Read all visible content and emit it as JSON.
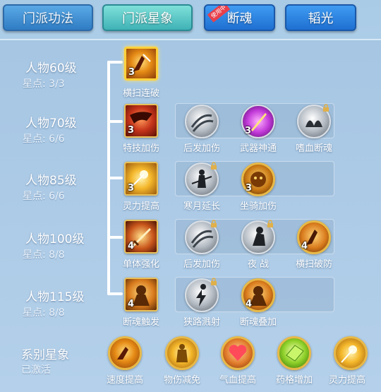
{
  "tabs": [
    {
      "label": "门派功法",
      "state": "inactive"
    },
    {
      "label": "门派星象",
      "state": "active"
    },
    {
      "label": "断魂",
      "state": "blue",
      "badge": "使用中"
    },
    {
      "label": "韬光",
      "state": "blue"
    }
  ],
  "rows": [
    {
      "level": "人物60级",
      "stars": "星点: 3/3",
      "skills": [
        {
          "name": "横扫连破",
          "count": "3",
          "icon": "sweep-icon",
          "selected": true
        }
      ]
    },
    {
      "level": "人物70级",
      "stars": "星点: 6/6",
      "skills": [
        {
          "name": "特技加伤",
          "count": "3",
          "icon": "claw-icon"
        },
        {
          "name": "后发加伤",
          "count": "",
          "icon": "slash-icon"
        },
        {
          "name": "武器神通",
          "count": "3",
          "icon": "blade-icon"
        },
        {
          "name": "嗜血断魂",
          "count": "",
          "icon": "beast-claw-icon",
          "locked": true
        }
      ]
    },
    {
      "level": "人物85级",
      "stars": "星点: 6/6",
      "skills": [
        {
          "name": "灵力提高",
          "count": "3",
          "icon": "spark-icon"
        },
        {
          "name": "寒月延长",
          "count": "",
          "icon": "warrior-icon",
          "locked": true
        },
        {
          "name": "坐骑加伤",
          "count": "3",
          "icon": "lion-icon"
        }
      ]
    },
    {
      "level": "人物100级",
      "stars": "星点: 8/8",
      "skills": [
        {
          "name": "单体强化",
          "count": "4",
          "icon": "sword-icon"
        },
        {
          "name": "后发加伤",
          "count": "",
          "icon": "slash-icon",
          "locked": true
        },
        {
          "name": "夜 战",
          "count": "",
          "icon": "knight-icon",
          "locked": true
        },
        {
          "name": "横扫破防",
          "count": "4",
          "icon": "sweep-icon"
        }
      ]
    },
    {
      "level": "人物115级",
      "stars": "星点: 8/8",
      "skills": [
        {
          "name": "断魂触发",
          "count": "4",
          "icon": "demon-icon"
        },
        {
          "name": "狭路溅射",
          "count": "",
          "icon": "dancer-icon",
          "locked": true
        },
        {
          "name": "断魂叠加",
          "count": "4",
          "icon": "demon-icon"
        }
      ]
    }
  ],
  "series": {
    "title": "系别星象",
    "status": "已激活",
    "items": [
      {
        "name": "速度提高",
        "icon": "speed-icon"
      },
      {
        "name": "物伤减免",
        "icon": "shield-figure-icon"
      },
      {
        "name": "气血提高",
        "icon": "heart-icon"
      },
      {
        "name": "药格增加",
        "icon": "gem-icon"
      },
      {
        "name": "灵力提高",
        "icon": "spark-icon"
      }
    ]
  },
  "colors": {
    "accent_gold": "#ffd13a",
    "tab_active": "#3fb2b6",
    "tab_blue": "#1f6fd1"
  }
}
